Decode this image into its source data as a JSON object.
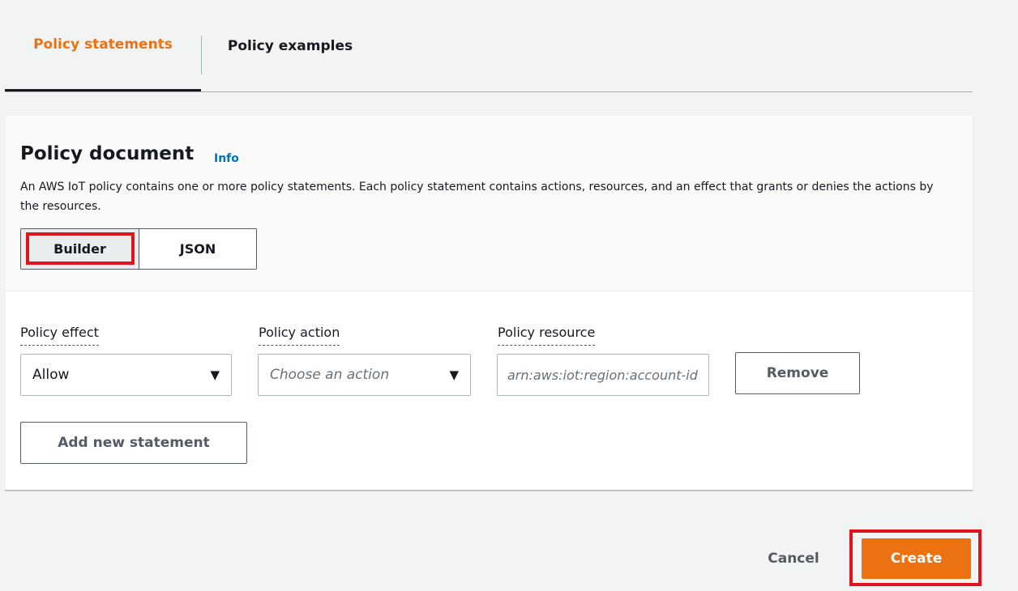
{
  "tabs": {
    "items": [
      {
        "label": "Policy statements",
        "active": true
      },
      {
        "label": "Policy examples",
        "active": false
      }
    ]
  },
  "policy_document": {
    "title": "Policy document",
    "info_label": "Info",
    "description": "An AWS IoT policy contains one or more policy statements. Each policy statement contains actions, resources, and an effect that grants or denies the actions by the resources.",
    "mode_options": [
      {
        "label": "Builder",
        "selected": true
      },
      {
        "label": "JSON",
        "selected": false
      }
    ]
  },
  "statement": {
    "effect_label": "Policy effect",
    "effect_value": "Allow",
    "action_label": "Policy action",
    "action_placeholder": "Choose an action",
    "resource_label": "Policy resource",
    "resource_placeholder": "arn:aws:iot:region:account-id:*",
    "remove_label": "Remove"
  },
  "add_statement_label": "Add new statement",
  "footer": {
    "cancel_label": "Cancel",
    "create_label": "Create"
  },
  "colors": {
    "accent": "#ec7211",
    "link": "#0073bb",
    "highlight": "#e0141e"
  },
  "icons": {
    "dropdown": "caret-down-icon"
  }
}
